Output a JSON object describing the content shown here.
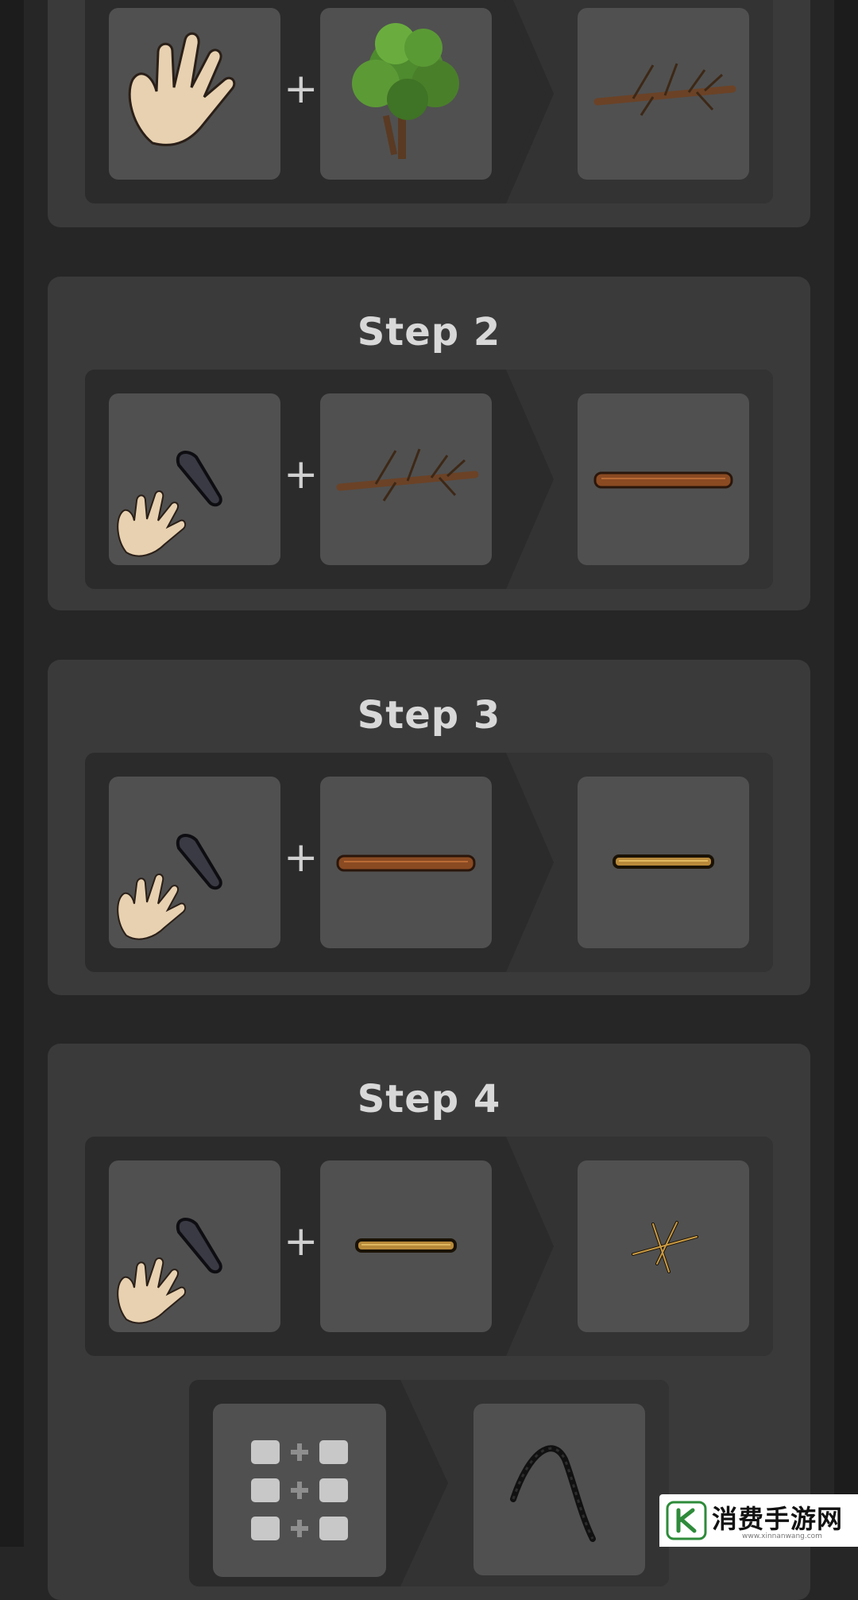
{
  "plus_symbol": "+",
  "steps": [
    {
      "title": "",
      "inputs": [
        "hand-icon",
        "tree-icon"
      ],
      "output": "branch-icon"
    },
    {
      "title": "Step 2",
      "inputs": [
        "sharp-stone-hand-icon",
        "branch-icon"
      ],
      "output": "long-shaft-icon"
    },
    {
      "title": "Step 3",
      "inputs": [
        "sharp-stone-hand-icon",
        "long-shaft-icon"
      ],
      "output": "short-shaft-icon"
    },
    {
      "title": "Step 4",
      "inputs": [
        "sharp-stone-hand-icon",
        "short-shaft-icon"
      ],
      "output": "kindling-icon"
    }
  ],
  "craft_result": {
    "input": "grid-recipe-icon",
    "output": "bow-string-icon"
  },
  "watermark": {
    "brand": "消费手游网",
    "url": "www.xinnanwang.com"
  },
  "colors": {
    "background": "#262626",
    "card": "#3a3a3a",
    "recipe_bg": "#2b2b2b",
    "slot": "#505050",
    "title_text": "#d8d8d8"
  }
}
